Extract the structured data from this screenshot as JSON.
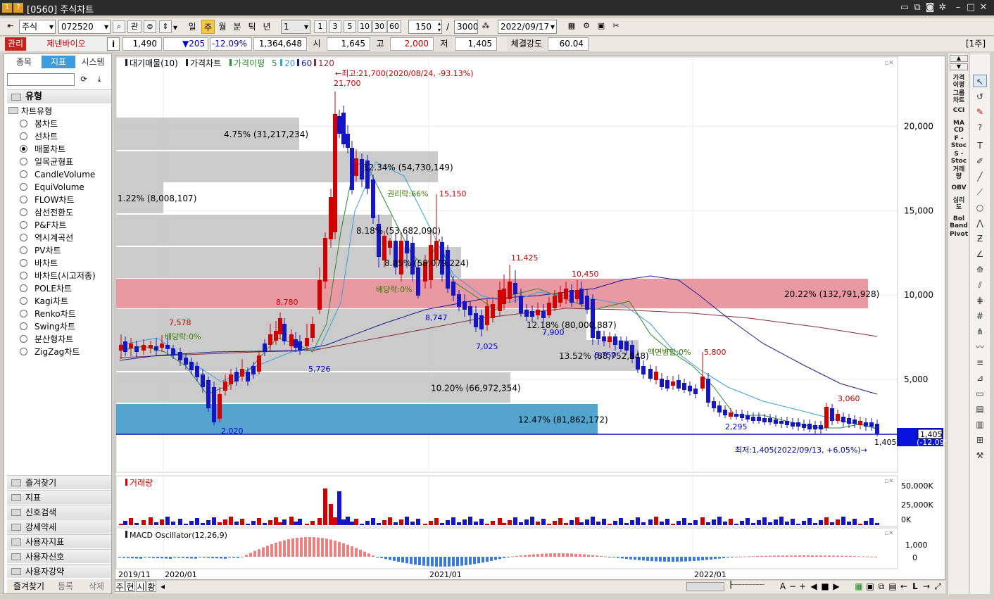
{
  "window": {
    "title": "[0560] 주식차트",
    "title_icons": [
      "1",
      "?"
    ]
  },
  "toolbar": {
    "market": "주식",
    "code": "072520",
    "kwan": "관",
    "periods": [
      "일",
      "주",
      "월",
      "분",
      "틱",
      "년"
    ],
    "active_period": "주",
    "multiplier": "1",
    "nums": [
      "1",
      "3",
      "5",
      "10",
      "30",
      "60"
    ],
    "count": "150",
    "slash": "/",
    "total": "3000",
    "date": "2022/09/17"
  },
  "quote": {
    "badge": "관리",
    "name": "제넨바이오",
    "info": "i",
    "price": "1,490",
    "change": "▼205",
    "pct": "-12.09%",
    "volume": "1,364,648",
    "open_label": "시",
    "open": "1,645",
    "high_label": "고",
    "high": "2,000",
    "low_label": "저",
    "low": "1,405",
    "strength_label": "체결강도",
    "strength": "60.04",
    "period_tag": "[1주]"
  },
  "left": {
    "tabs": [
      "종목",
      "지표",
      "시스템"
    ],
    "active_tab": "지표",
    "group_title": "유형",
    "tree_root": "차트유형",
    "chart_types": [
      "봉차트",
      "선차트",
      "매물차트",
      "일목균형표",
      "CandleVolume",
      "EquiVolume",
      "FLOW차트",
      "삼선전환도",
      "P&F차트",
      "역시계곡선",
      "PV차트",
      "바차트",
      "바차트(시고저종)",
      "POLE차트",
      "Kagi차트",
      "Renko차트",
      "Swing차트",
      "분산형차트",
      "ZigZag차트"
    ],
    "selected": "매물차트",
    "sections": [
      "즐겨찾기",
      "지표",
      "신호검색",
      "강세약세",
      "사용자지표",
      "사용자신호",
      "사용자강약"
    ],
    "footer": [
      "즐겨찾기",
      "등록",
      "삭제"
    ]
  },
  "chart": {
    "legend": {
      "vp": "대기매물(10)",
      "price": "가격차트",
      "ma": "가격이평",
      "ma5": "5",
      "ma20": "20",
      "ma60": "60",
      "ma120": "120"
    },
    "yticks": [
      "20,000",
      "15,000",
      "10,000",
      "5,000"
    ],
    "xticks": [
      "2019/11",
      "2020/01",
      "2021/01",
      "2022/01"
    ],
    "vp_labels": [
      "4.75% (31,217,234)",
      "12.34% (54,730,149)",
      "1.22% (8,008,107)",
      "8.18% (53,682,090)",
      "8.85% (58,079,224)",
      "20.22% (132,791,928)",
      "12.18% (80,000,887)",
      "13.52% (88,752,848)",
      "10.20% (66,972,354)",
      "12.47% (81,862,172)"
    ],
    "annotations": {
      "max": "←최고:21,700(2020/08/24, -93.13%)",
      "min": "최저:1,405(2022/09/13, +6.05%)→",
      "h21700": "21,700",
      "h15150": "15,150",
      "h11425": "11,425",
      "h10450": "10,450",
      "h8780": "8,780",
      "h7578": "7,578",
      "h5800": "5,800",
      "h3060": "3,060",
      "l2020": "2,020",
      "l5726": "5,726",
      "l8747": "8,747",
      "l7025": "7,025",
      "l7900": "7,900",
      "l2295": "2,295",
      "l1405": "1,405",
      "l6750": "6,750",
      "rights": "권리락:66%",
      "div1": "배당락:0%",
      "div2": "배당락:0%",
      "split": "액면병합:0%",
      "cur_price": "1,405",
      "cur_pct": "(-12.09%)"
    },
    "volume": {
      "title": "거래량",
      "ticks": [
        "50,000K",
        "25,000K",
        "0K"
      ]
    },
    "macd": {
      "title": "MACD Oscillator(12,26,9)",
      "ticks": [
        "1,000",
        "0"
      ]
    }
  },
  "rightbar": [
    "가격 이평",
    "그룹 차트",
    "CCI",
    "MA CD",
    "F - Stoc",
    "S - Stoc",
    "거래 량",
    "OBV",
    "심리 도",
    "Bol Band",
    "Pivot"
  ],
  "bottom": {
    "tabs": [
      "주",
      "현",
      "시",
      "황"
    ]
  },
  "colors": {
    "up": "#d40000",
    "down": "#1414c8",
    "vp_gray": "#c8c8c8",
    "vp_red": "#e8949c",
    "vp_blue": "#4aa0cc",
    "ma5": "#2e8b2e",
    "ma20": "#3aa0dc",
    "ma60": "#1c1c96",
    "ma120": "#8c2a3c"
  }
}
